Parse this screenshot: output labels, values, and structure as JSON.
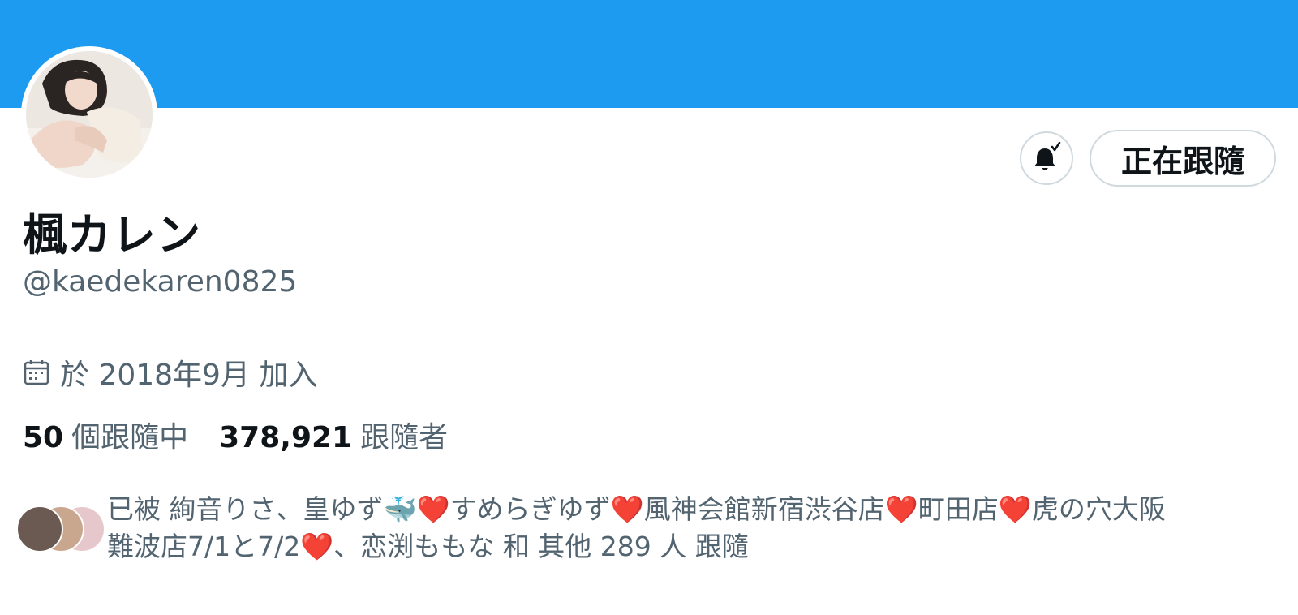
{
  "profile": {
    "display_name": "楓カレン",
    "handle": "@kaedekaren0825",
    "joined": "於 2018年9月 加入"
  },
  "actions": {
    "follow_label": "正在跟隨"
  },
  "stats": {
    "following_count": "50",
    "following_label": "個跟隨中",
    "followers_count": "378,921",
    "followers_label": "跟隨者"
  },
  "followed_by": {
    "text_line1": "已被 絢音りさ、皇ゆず🐳❤️すめらぎゆず❤️風神会館新宿渋谷店❤️町田店❤️虎の穴大阪",
    "text_line2": "難波店7/1と7/2❤️、恋渕ももな 和 其他 289 人 跟隨"
  },
  "icons": {
    "bell": "bell-check-icon",
    "calendar": "calendar-icon"
  },
  "colors": {
    "banner": "#1d9bf0",
    "secondary_text": "#536471",
    "primary_text": "#0f1419",
    "border": "#cfd9de"
  }
}
